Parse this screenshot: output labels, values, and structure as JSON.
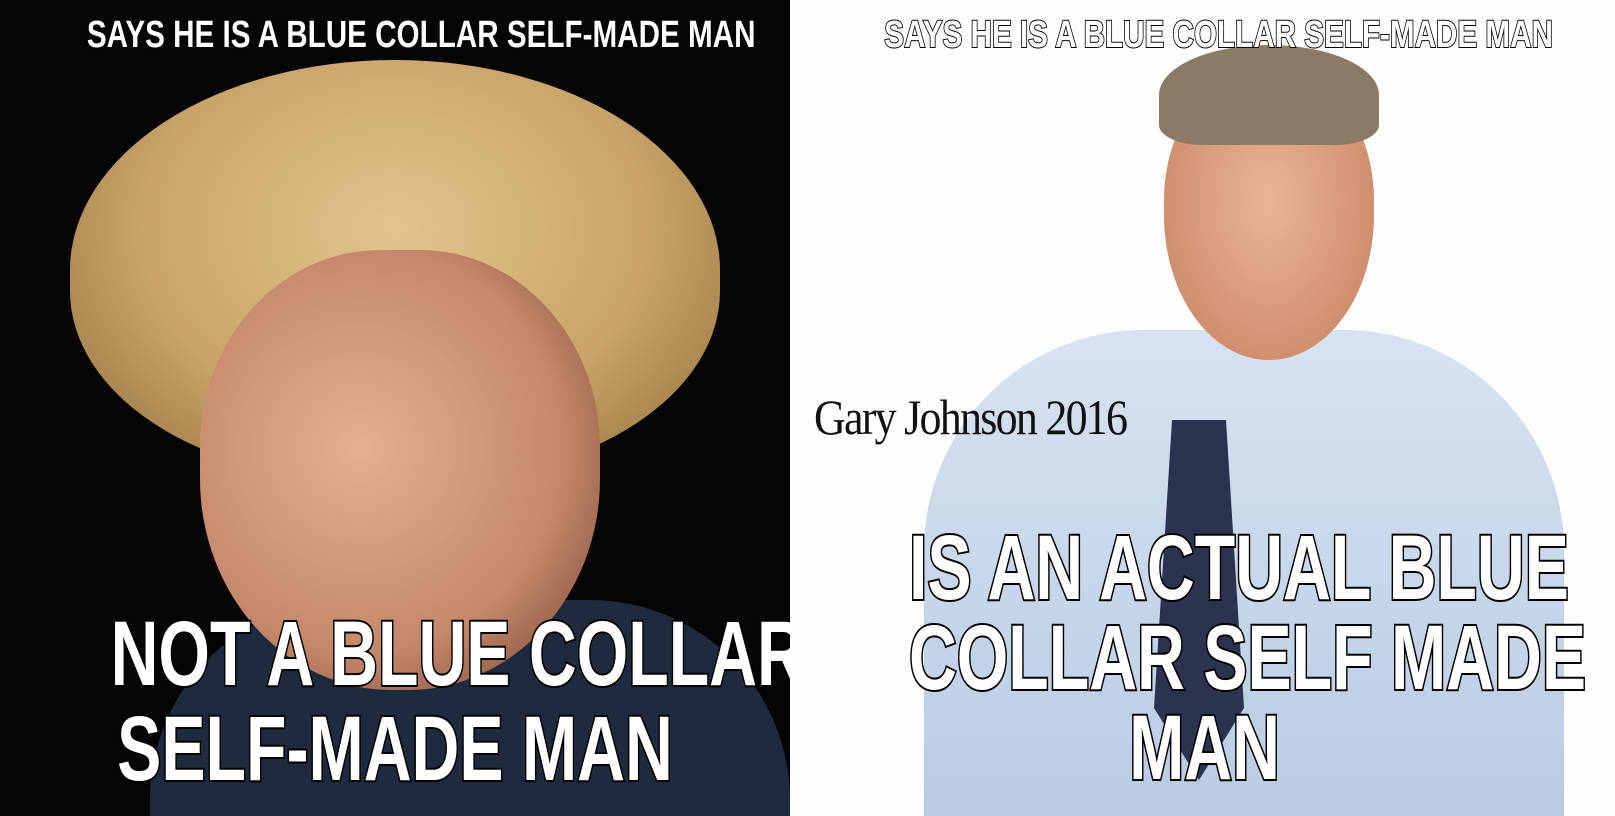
{
  "left_panel": {
    "top_text": "SAYS HE IS A BLUE COLLAR SELF-MADE MAN",
    "bottom_lines": [
      "NOT A BLUE COLLAR",
      "SELF-MADE MAN"
    ],
    "colors": {
      "background": "#050505",
      "hair": "#c9a468",
      "skin": "#d49a7c",
      "jacket": "#1e2a3e"
    }
  },
  "right_panel": {
    "top_text": "SAYS HE IS A BLUE COLLAR SELF-MADE MAN",
    "caption": "Gary Johnson 2016",
    "bottom_lines": [
      "IS AN ACTUAL BLUE",
      "COLLAR SELF MADE",
      "MAN"
    ],
    "colors": {
      "background": "#fdfdfd",
      "shirt": "#c9d8ec",
      "skin": "#e0a78a",
      "hair": "#8a7a66",
      "tie": "#2a3350"
    }
  }
}
